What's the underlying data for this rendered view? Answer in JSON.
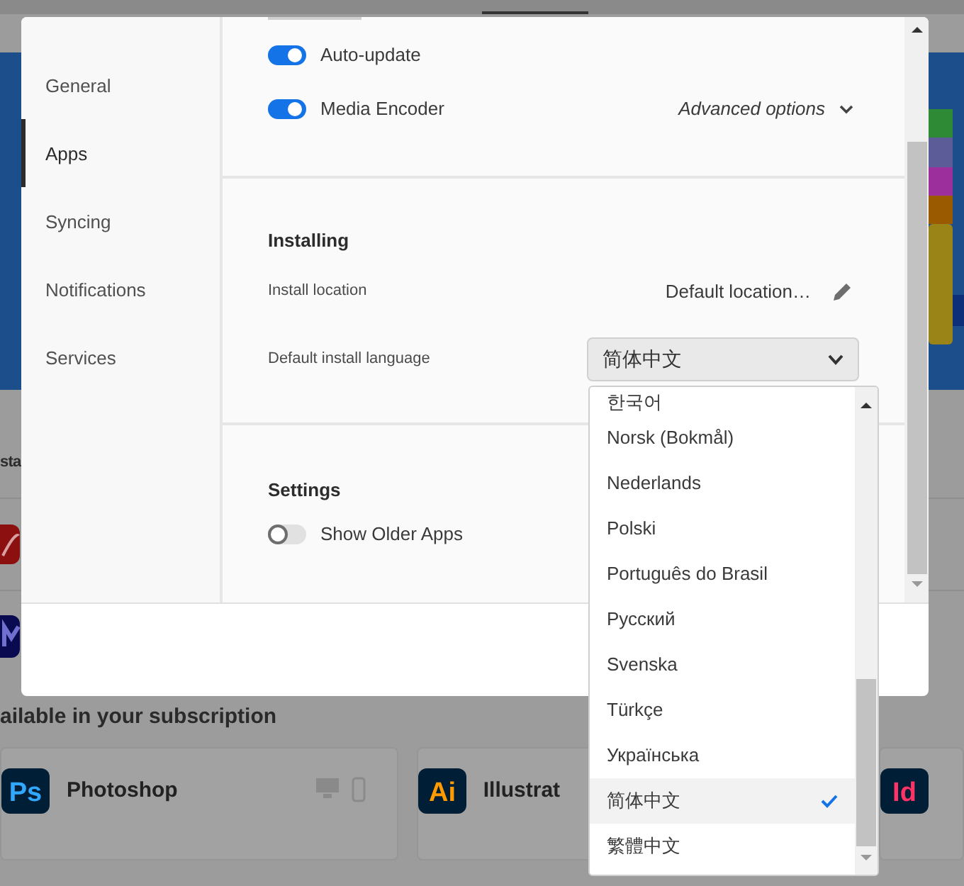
{
  "background": {
    "section_heading": "sta",
    "installed_apps": [
      {
        "kind": "swirl"
      },
      {
        "kind": "navy"
      }
    ],
    "subscription_heading": "ailable in your subscription",
    "app_cards": [
      {
        "icon": "Ps",
        "name": "Photoshop",
        "color": "#31a8ff",
        "devices": true
      },
      {
        "icon": "Ai",
        "name": "Illustrat",
        "color": "#ff9a00"
      },
      {
        "icon": "Id",
        "color": "#ff3366"
      }
    ]
  },
  "dialog": {
    "sidebar": {
      "items": [
        {
          "label": "General",
          "selected": false
        },
        {
          "label": "Apps",
          "selected": true
        },
        {
          "label": "Syncing",
          "selected": false
        },
        {
          "label": "Notifications",
          "selected": false
        },
        {
          "label": "Services",
          "selected": false
        }
      ]
    },
    "update_section": {
      "toggles": [
        {
          "label": "Auto-update",
          "on": true
        },
        {
          "label": "Media Encoder",
          "on": true
        }
      ],
      "advanced_link": "Advanced options"
    },
    "installing_section": {
      "heading": "Installing",
      "install_location": {
        "label": "Install location",
        "value": "Default location…"
      },
      "install_language": {
        "label": "Default install language",
        "value": "简体中文"
      }
    },
    "settings_section": {
      "heading": "Settings",
      "toggles": [
        {
          "label": "Show Older Apps",
          "on": false
        }
      ]
    }
  },
  "language_dropdown": {
    "options": [
      {
        "label": "한국어",
        "selected": false
      },
      {
        "label": "Norsk (Bokmål)",
        "selected": false
      },
      {
        "label": "Nederlands",
        "selected": false
      },
      {
        "label": "Polski",
        "selected": false
      },
      {
        "label": "Português do Brasil",
        "selected": false
      },
      {
        "label": "Русский",
        "selected": false
      },
      {
        "label": "Svenska",
        "selected": false
      },
      {
        "label": "Türkçe",
        "selected": false
      },
      {
        "label": "Українська",
        "selected": false
      },
      {
        "label": "简体中文",
        "selected": true
      },
      {
        "label": "繁體中文",
        "selected": false
      }
    ]
  }
}
